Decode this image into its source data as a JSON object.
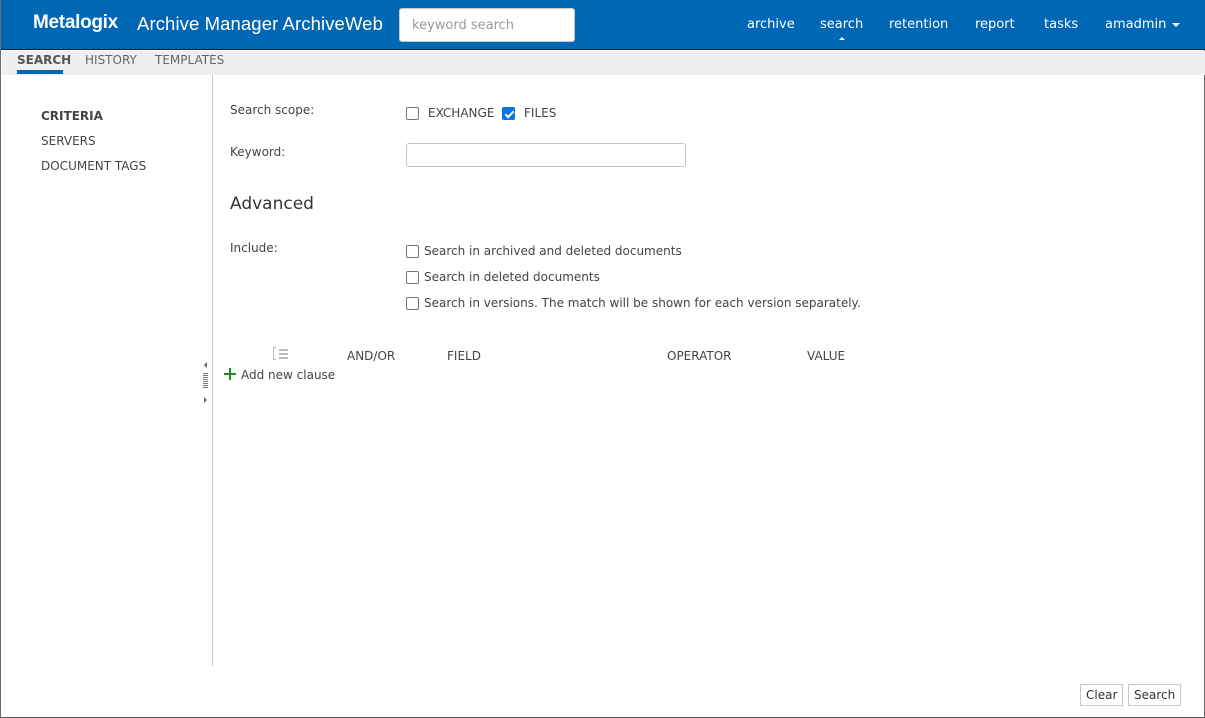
{
  "header": {
    "logo": "Metalogix",
    "app_title": "Archive Manager ArchiveWeb",
    "search_placeholder": "keyword search",
    "nav": [
      {
        "label": "archive",
        "active": false
      },
      {
        "label": "search",
        "active": true
      },
      {
        "label": "retention",
        "active": false
      },
      {
        "label": "report",
        "active": false
      },
      {
        "label": "tasks",
        "active": false
      }
    ],
    "user": "amadmin"
  },
  "subtabs": [
    {
      "label": "SEARCH",
      "active": true
    },
    {
      "label": "HISTORY",
      "active": false
    },
    {
      "label": "TEMPLATES",
      "active": false
    }
  ],
  "leftnav": [
    {
      "label": "CRITERIA",
      "active": true
    },
    {
      "label": "SERVERS",
      "active": false
    },
    {
      "label": "DOCUMENT TAGS",
      "active": false
    }
  ],
  "form": {
    "scope_label": "Search scope:",
    "scope_options": [
      {
        "label": "EXCHANGE",
        "checked": false
      },
      {
        "label": "FILES",
        "checked": true
      }
    ],
    "keyword_label": "Keyword:",
    "keyword_value": "",
    "advanced_title": "Advanced",
    "include_label": "Include:",
    "include_options": [
      {
        "label": "Search in archived and deleted documents",
        "checked": false
      },
      {
        "label": "Search in deleted documents",
        "checked": false
      },
      {
        "label": "Search in versions. The match will be shown for each version separately.",
        "checked": false
      }
    ]
  },
  "clauses": {
    "columns": [
      "AND/OR",
      "FIELD",
      "OPERATOR",
      "VALUE"
    ],
    "add_label": "Add new clause"
  },
  "buttons": {
    "clear": "Clear",
    "search": "Search"
  },
  "colors": {
    "brand": "#0067b4",
    "checkbox_checked": "#0a74e0",
    "add_icon": "#1f8a1f"
  }
}
